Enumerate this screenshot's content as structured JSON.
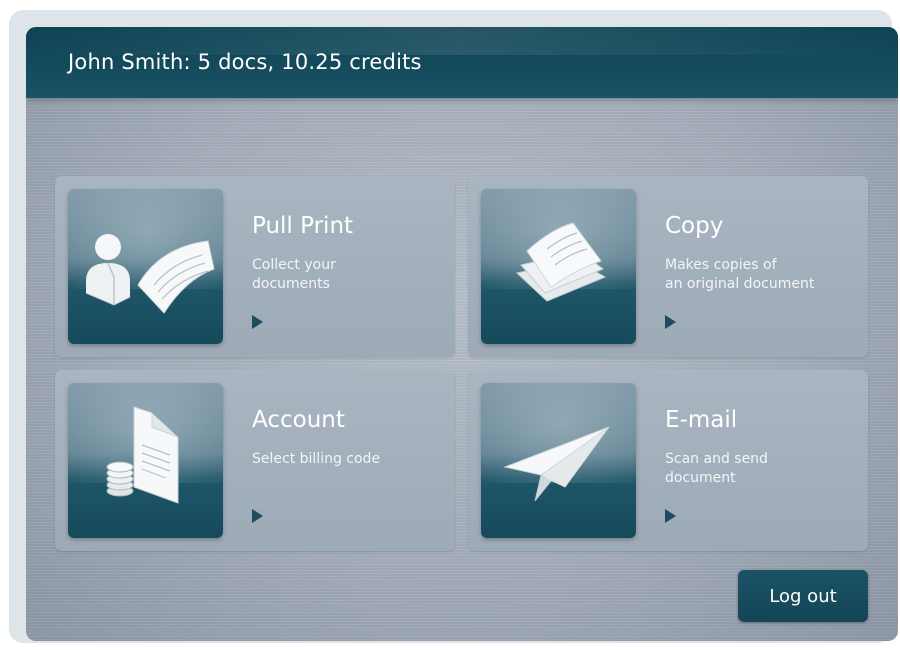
{
  "header": {
    "title": "John Smith: 5 docs, 10.25 credits"
  },
  "tiles": [
    {
      "title": "Pull Print",
      "description": [
        "Collect your",
        "documents"
      ],
      "icon": "user-document-icon"
    },
    {
      "title": "Copy",
      "description": [
        "Makes copies of",
        "an original document"
      ],
      "icon": "copy-pages-icon"
    },
    {
      "title": "Account",
      "description": [
        "Select billing code"
      ],
      "icon": "billing-coins-icon"
    },
    {
      "title": "E-mail",
      "description": [
        "Scan and send",
        "document"
      ],
      "icon": "paper-plane-icon"
    }
  ],
  "logout_label": "Log out",
  "colors": {
    "header": "#144b5c",
    "tile": "#a3afbc",
    "button": "#174c5e",
    "arrow": "#1d4c5f"
  }
}
